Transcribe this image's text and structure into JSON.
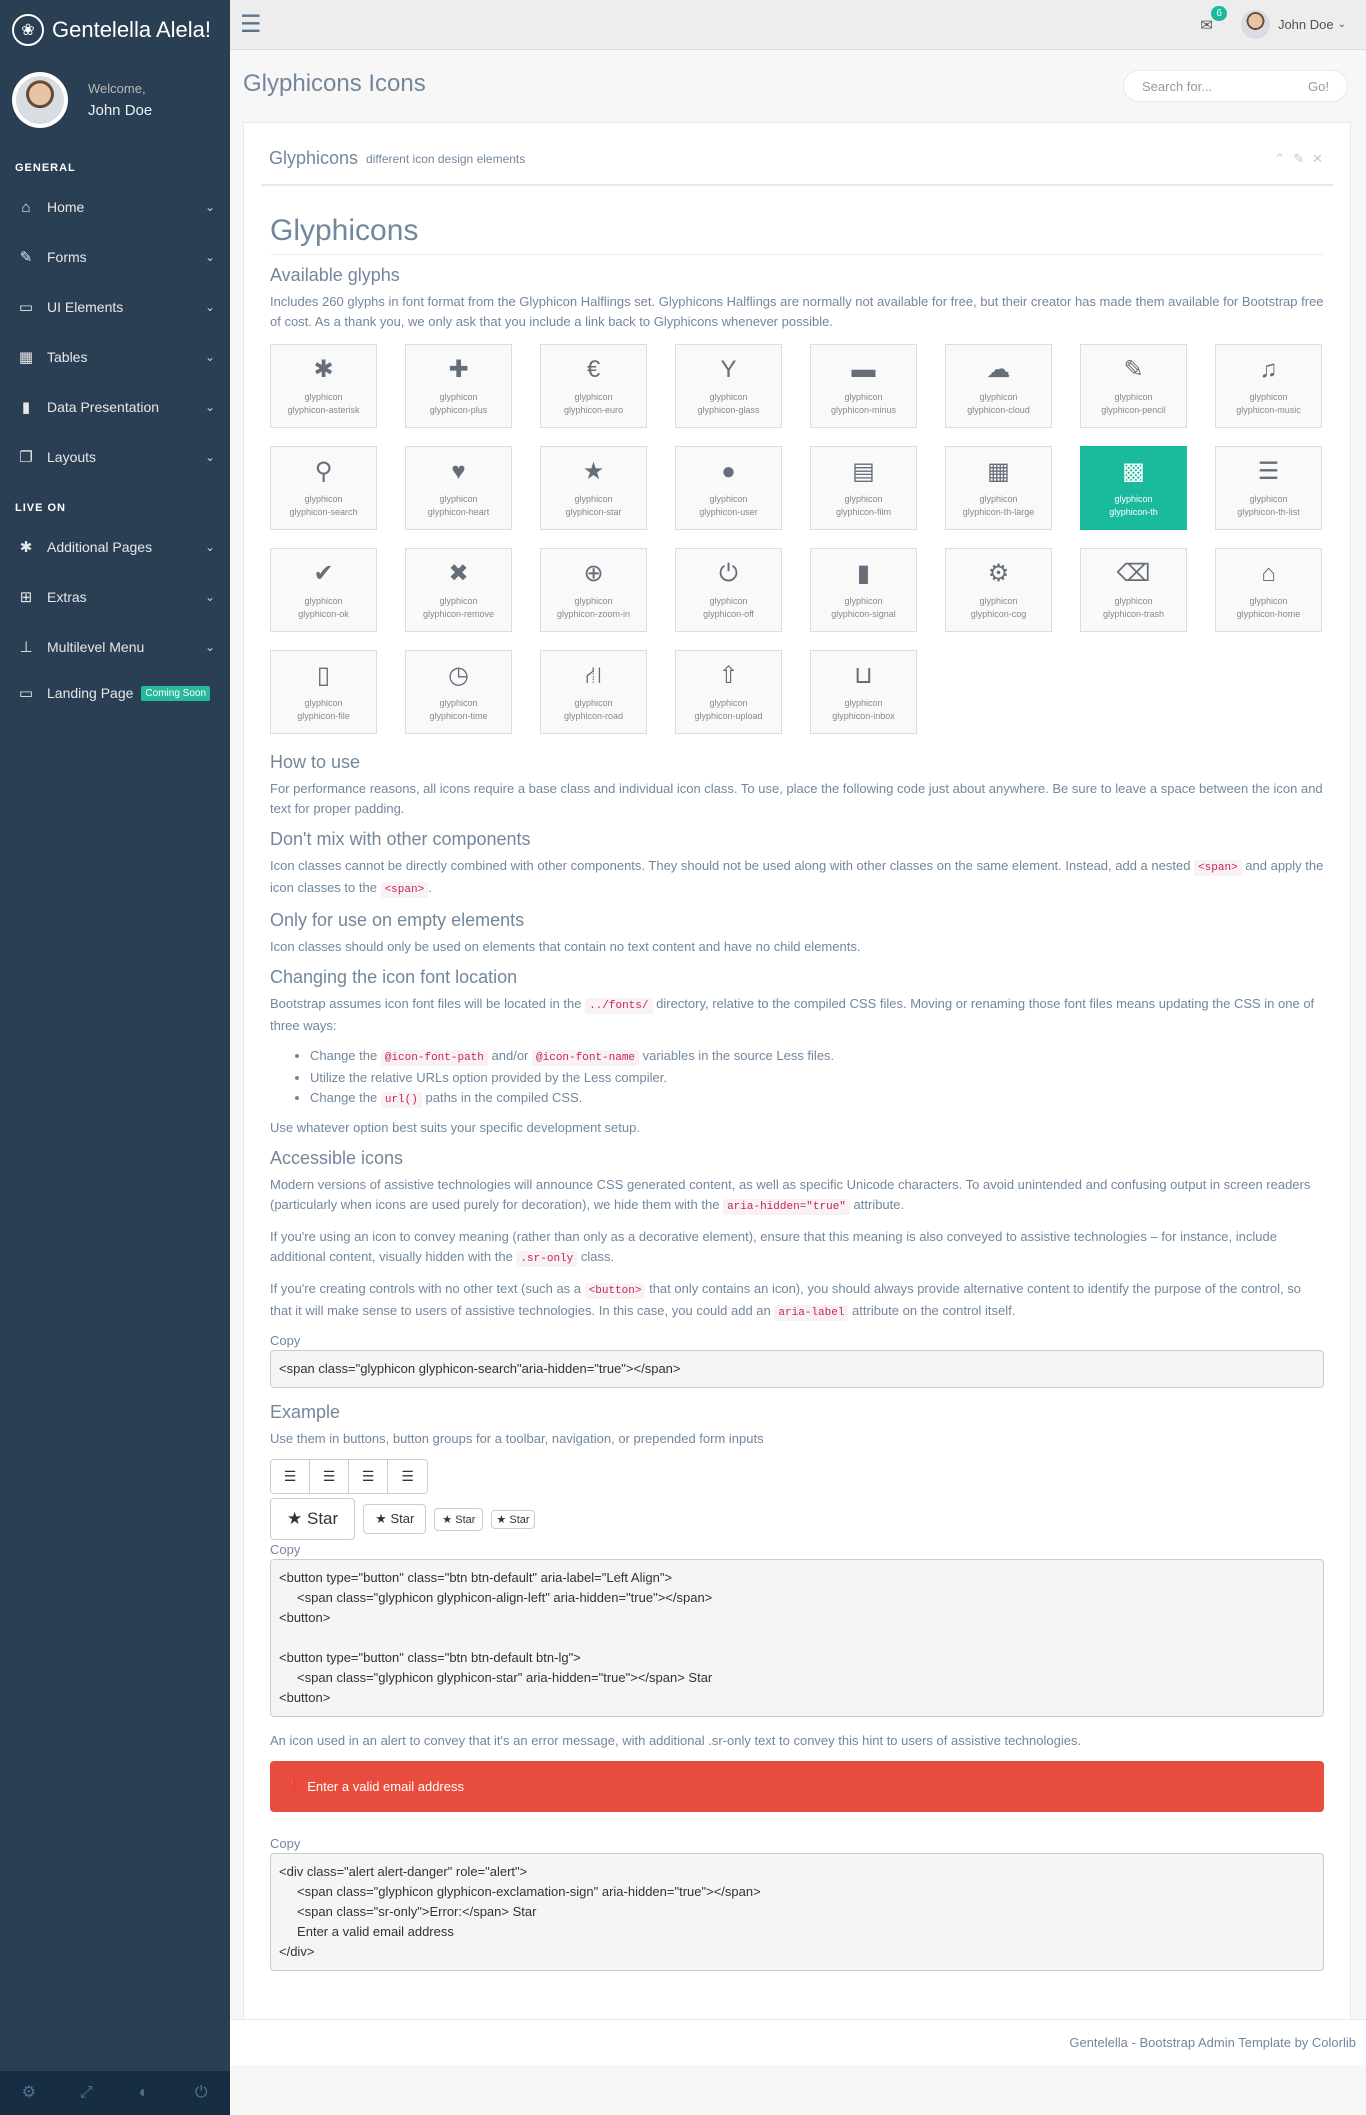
{
  "app": {
    "brand": "Gentelella Alela!",
    "brand_icon": "paw-icon"
  },
  "profile": {
    "welcome": "Welcome,",
    "name": "John Doe"
  },
  "sidebar": {
    "general_title": "GENERAL",
    "general": [
      {
        "label": "Home",
        "icon": "home-icon",
        "glyph": "⌂"
      },
      {
        "label": "Forms",
        "icon": "edit-icon",
        "glyph": "✎"
      },
      {
        "label": "UI Elements",
        "icon": "desktop-icon",
        "glyph": "▭"
      },
      {
        "label": "Tables",
        "icon": "table-icon",
        "glyph": "▦"
      },
      {
        "label": "Data Presentation",
        "icon": "bar-chart-icon",
        "glyph": "▮"
      },
      {
        "label": "Layouts",
        "icon": "clone-icon",
        "glyph": "❐"
      }
    ],
    "live_title": "LIVE ON",
    "live": [
      {
        "label": "Additional Pages",
        "icon": "bug-icon",
        "glyph": "✱"
      },
      {
        "label": "Extras",
        "icon": "windows-icon",
        "glyph": "⊞"
      },
      {
        "label": "Multilevel Menu",
        "icon": "sitemap-icon",
        "glyph": "⊥"
      }
    ],
    "landing": {
      "label": "Landing Page",
      "badge": "Coming Soon"
    },
    "footer": [
      "⚙",
      "⤢",
      "◐",
      "⏻"
    ]
  },
  "topnav": {
    "mail_count": "6",
    "user": "John Doe"
  },
  "page": {
    "title": "Glyphicons Icons",
    "search_placeholder": "Search for...",
    "search_btn": "Go!"
  },
  "panel": {
    "title": "Glyphicons",
    "subtitle": "different icon design elements"
  },
  "content": {
    "h1": "Glyphicons",
    "available": "Available glyphs",
    "available_p": "Includes 260 glyphs in font format from the Glyphicon Halflings set. Glyphicons Halflings are normally not available for free, but their creator has made them available for Bootstrap free of cost. As a thank you, we only ask that you include a link back to Glyphicons whenever possible.",
    "howto": "How to use",
    "howto_p": "For performance reasons, all icons require a base class and individual icon class. To use, place the following code just about anywhere. Be sure to leave a space between the icon and text for proper padding.",
    "nomix": "Don't mix with other components",
    "nomix_p1": "Icon classes cannot be directly combined with other components. They should not be used along with other classes on the same element. Instead, add a nested",
    "nomix_p2": "and apply the icon classes to the",
    "span_code": "<span>",
    "empty": "Only for use on empty elements",
    "empty_p": "Icon classes should only be used on elements that contain no text content and have no child elements.",
    "change": "Changing the icon font location",
    "change_p1": "Bootstrap assumes icon font files will be located in the",
    "fonts_code": "../fonts/",
    "change_p2": "directory, relative to the compiled CSS files. Moving or renaming those font files means updating the CSS in one of three ways:",
    "li1a": "Change the",
    "li1code1": "@icon-font-path",
    "li1b": "and/or",
    "li1code2": "@icon-font-name",
    "li1c": "variables in the source Less files.",
    "li2": "Utilize the relative URLs option provided by the Less compiler.",
    "li3a": "Change the",
    "li3code": "url()",
    "li3b": "paths in the compiled CSS.",
    "change_p3": "Use whatever option best suits your specific development setup.",
    "access": "Accessible icons",
    "access_p1a": "Modern versions of assistive technologies will announce CSS generated content, as well as specific Unicode characters. To avoid unintended and confusing output in screen readers (particularly when icons are used purely for decoration), we hide them with the",
    "aria_hidden_code": "aria-hidden=\"true\"",
    "access_p1b": "attribute.",
    "access_p2a": "If you're using an icon to convey meaning (rather than only as a decorative element), ensure that this meaning is also conveyed to assistive technologies – for instance, include additional content, visually hidden with the",
    "sronly_code": ".sr-only",
    "access_p2b": "class.",
    "access_p3a": "If you're creating controls with no other text (such as a",
    "button_code": "<button>",
    "access_p3b": "that only contains an icon), you should always provide alternative content to identify the purpose of the control, so that it will make sense to users of assistive technologies. In this case, you could add an",
    "arialabel_code": "aria-label",
    "access_p3c": "attribute on the control itself.",
    "copy": "Copy",
    "code1": "<span class=\"glyphicon glyphicon-search\"aria-hidden=\"true\"></span>",
    "example": "Example",
    "example_p": "Use them in buttons, button groups for a toolbar, navigation, or prepended form inputs",
    "star": "Star",
    "code2": "<button type=\"button\" class=\"btn btn-default\" aria-label=\"Left Align\">\n     <span class=\"glyphicon glyphicon-align-left\" aria-hidden=\"true\"></span>\n<button>\n\n<button type=\"button\" class=\"btn btn-default btn-lg\">\n     <span class=\"glyphicon glyphicon-star\" aria-hidden=\"true\"></span> Star\n<button>",
    "alert_p": "An icon used in an alert to convey that it's an error message, with additional .sr-only text to convey this hint to users of assistive technologies.",
    "alert_text": "Enter a valid email address",
    "code3": "<div class=\"alert alert-danger\" role=\"alert\">\n     <span class=\"glyphicon glyphicon-exclamation-sign\" aria-hidden=\"true\"></span>\n     <span class=\"sr-only\">Error:</span> Star\n     Enter a valid email address\n</div>"
  },
  "glyphs": [
    {
      "g": "✱",
      "a": "glyphicon",
      "b": "glyphicon-asterisk",
      "icon": "asterisk-icon"
    },
    {
      "g": "✚",
      "a": "glyphicon",
      "b": "glyphicon-plus",
      "icon": "plus-icon"
    },
    {
      "g": "€",
      "a": "glyphicon",
      "b": "glyphicon-euro",
      "icon": "euro-icon"
    },
    {
      "g": "Y",
      "a": "glyphicon",
      "b": "glyphicon-glass",
      "icon": "glass-icon"
    },
    {
      "g": "▬",
      "a": "glyphicon",
      "b": "glyphicon-minus",
      "icon": "minus-icon"
    },
    {
      "g": "☁",
      "a": "glyphicon",
      "b": "glyphicon-cloud",
      "icon": "cloud-icon"
    },
    {
      "g": "✎",
      "a": "glyphicon",
      "b": "glyphicon-pencil",
      "icon": "pencil-icon"
    },
    {
      "g": "♫",
      "a": "glyphicon",
      "b": "glyphicon-music",
      "icon": "music-icon"
    },
    {
      "g": "⚲",
      "a": "glyphicon",
      "b": "glyphicon-search",
      "icon": "search-icon"
    },
    {
      "g": "♥",
      "a": "glyphicon",
      "b": "glyphicon-heart",
      "icon": "heart-icon"
    },
    {
      "g": "★",
      "a": "glyphicon",
      "b": "glyphicon-star",
      "icon": "star-icon"
    },
    {
      "g": "●",
      "a": "glyphicon",
      "b": "glyphicon-user",
      "icon": "user-icon"
    },
    {
      "g": "▤",
      "a": "glyphicon",
      "b": "glyphicon-film",
      "icon": "film-icon"
    },
    {
      "g": "▦",
      "a": "glyphicon",
      "b": "glyphicon-th-large",
      "icon": "th-large-icon"
    },
    {
      "g": "▩",
      "a": "glyphicon",
      "b": "glyphicon-th",
      "icon": "th-icon",
      "active": true
    },
    {
      "g": "☰",
      "a": "glyphicon",
      "b": "glyphicon-th-list",
      "icon": "th-list-icon"
    },
    {
      "g": "✔",
      "a": "glyphicon",
      "b": "glyphicon-ok",
      "icon": "ok-icon"
    },
    {
      "g": "✖",
      "a": "glyphicon",
      "b": "glyphicon-remove",
      "icon": "remove-icon"
    },
    {
      "g": "⊕",
      "a": "glyphicon",
      "b": "glyphicon-zoom-in",
      "icon": "zoom-in-icon"
    },
    {
      "g": "⏻",
      "a": "glyphicon",
      "b": "glyphicon-off",
      "icon": "off-icon"
    },
    {
      "g": "▮",
      "a": "glyphicon",
      "b": "glyphicon-signal",
      "icon": "signal-icon"
    },
    {
      "g": "⚙",
      "a": "glyphicon",
      "b": "glyphicon-cog",
      "icon": "cog-icon"
    },
    {
      "g": "⌫",
      "a": "glyphicon",
      "b": "glyphicon-trash",
      "icon": "trash-icon"
    },
    {
      "g": "⌂",
      "a": "glyphicon",
      "b": "glyphicon-home",
      "icon": "home-icon"
    },
    {
      "g": "▯",
      "a": "glyphicon",
      "b": "glyphicon-file",
      "icon": "file-icon"
    },
    {
      "g": "◷",
      "a": "glyphicon",
      "b": "glyphicon-time",
      "icon": "time-icon"
    },
    {
      "g": "⛙",
      "a": "glyphicon",
      "b": "glyphicon-road",
      "icon": "road-icon"
    },
    {
      "g": "⇧",
      "a": "glyphicon",
      "b": "glyphicon-upload",
      "icon": "upload-icon"
    },
    {
      "g": "⊔",
      "a": "glyphicon",
      "b": "glyphicon-inbox",
      "icon": "inbox-icon"
    }
  ],
  "footer": {
    "text": "Gentelella - Bootstrap Admin Template by Colorlib"
  }
}
